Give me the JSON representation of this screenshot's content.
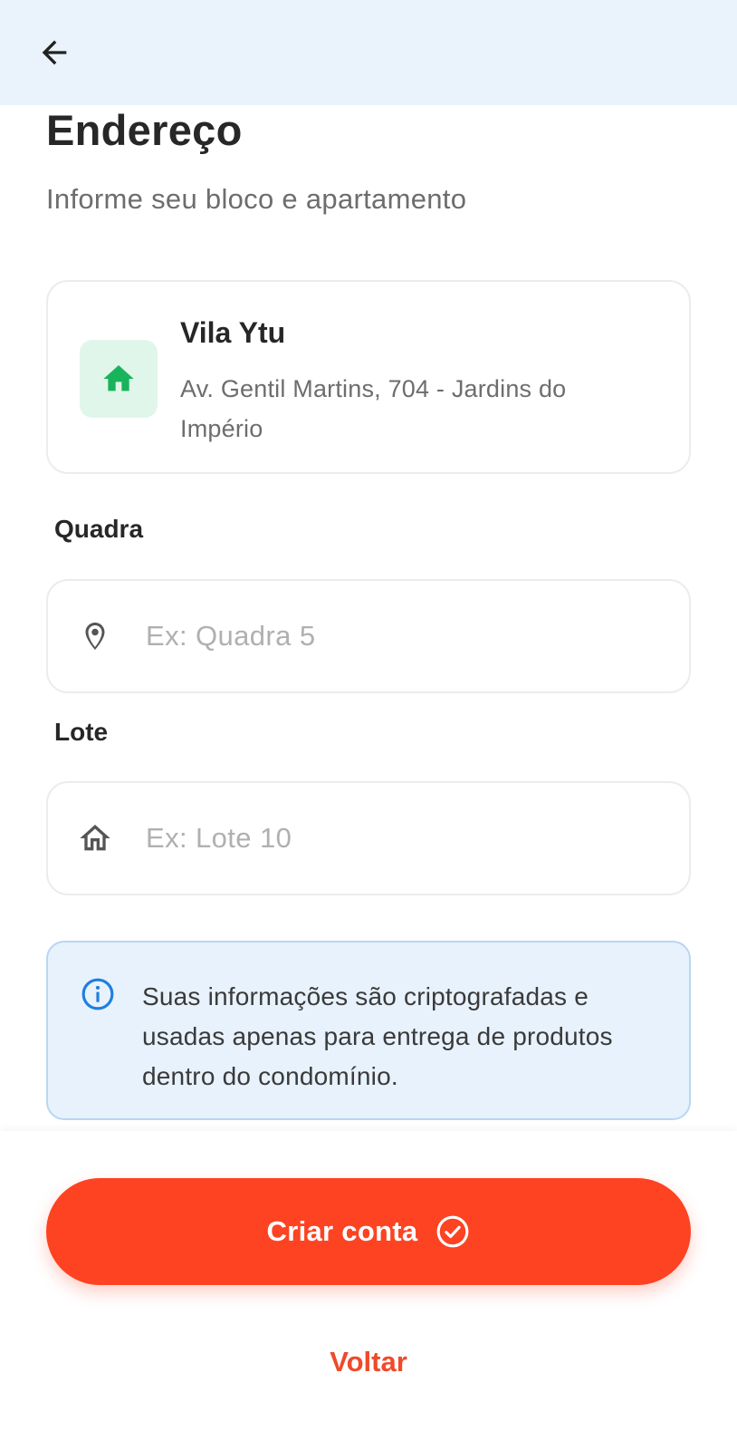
{
  "header": {
    "back_icon": "arrow-left-icon"
  },
  "page": {
    "title": "Endereço",
    "subtitle": "Informe seu bloco e apartamento"
  },
  "condo": {
    "icon": "home-icon",
    "icon_color": "#18b45c",
    "name": "Vila Ytu",
    "address": "Av. Gentil Martins, 704 - Jardins do Império"
  },
  "fields": {
    "quadra": {
      "label": "Quadra",
      "icon": "location-pin-icon",
      "value": "",
      "placeholder": "Ex: Quadra 5"
    },
    "lote": {
      "label": "Lote",
      "icon": "house-outline-icon",
      "value": "",
      "placeholder": "Ex: Lote 10"
    }
  },
  "info": {
    "icon": "info-icon",
    "text": "Suas informações são criptografadas e usadas apenas para entrega de produtos dentro do condomínio."
  },
  "actions": {
    "primary_label": "Criar conta",
    "primary_icon": "check-circle-icon",
    "secondary_label": "Voltar"
  },
  "colors": {
    "accent": "#fd4322",
    "header_bg": "#eaf2fb",
    "info_bg": "#e8f2fc",
    "info_border": "#b9d6f2"
  }
}
